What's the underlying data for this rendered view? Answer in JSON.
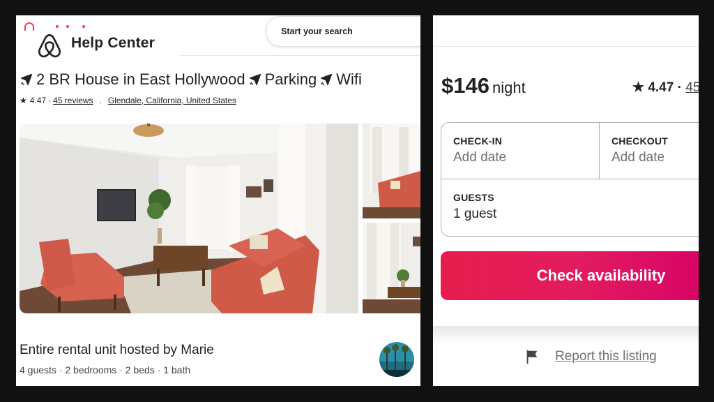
{
  "header": {
    "title": "Help Center",
    "search_placeholder": "Start your search"
  },
  "listing": {
    "title_parts": [
      "2 BR House in East Hollywood",
      "Parking",
      "Wifi"
    ],
    "rating": "4.47",
    "rating_sep": "·",
    "reviews_link": "45 reviews",
    "dot_sep": ".",
    "location_link": "Glendale, California, United States"
  },
  "host": {
    "title": "Entire rental unit hosted by Marie",
    "details": "4 guests · 2 bedrooms · 2 beds · 1 bath"
  },
  "booking": {
    "price": "$146",
    "per": "night",
    "rating": "4.47 ·",
    "reviews_partial": "45",
    "checkin_label": "CHECK-IN",
    "checkin_value": "Add date",
    "checkout_label": "CHECKOUT",
    "checkout_value": "Add date",
    "guests_label": "GUESTS",
    "guests_value": "1 guest",
    "cta_label": "Check availability",
    "report_label": "Report this listing"
  },
  "icons": {
    "logo": "airbnb-logo-icon",
    "plane": "airplane-icon",
    "star": "star-icon",
    "flag": "flag-icon"
  },
  "colors": {
    "brand": "#FF385C",
    "cta_start": "#E61E4D",
    "cta_end": "#D70466",
    "text": "#222222",
    "muted": "#717171",
    "background": "#111111"
  }
}
